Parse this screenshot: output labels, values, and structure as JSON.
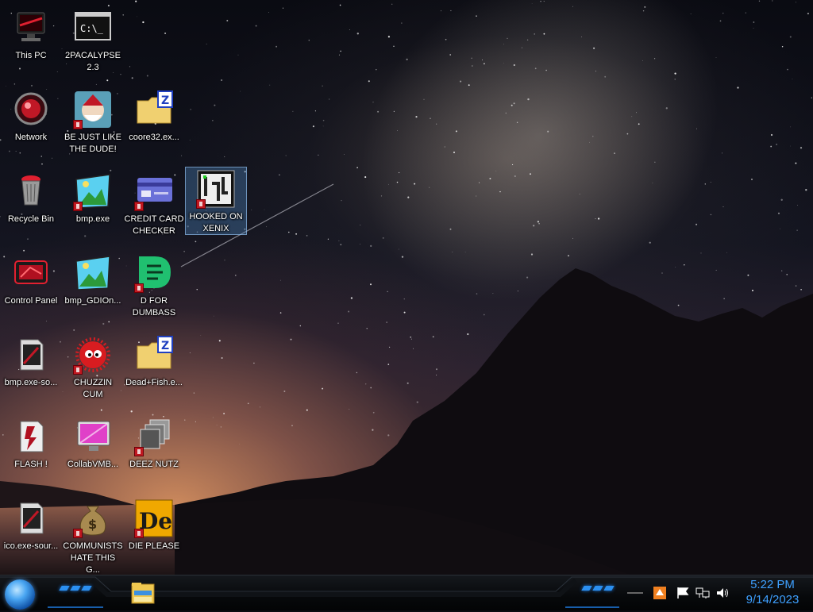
{
  "desktop": {
    "icons": [
      {
        "id": "this-pc",
        "label": "This PC"
      },
      {
        "id": "2pacalypse",
        "label": "2PACALYPSE 2.3"
      },
      {
        "id": "network",
        "label": "Network"
      },
      {
        "id": "be-just-like",
        "label": "BE JUST LIKE THE DUDE!"
      },
      {
        "id": "coore32",
        "label": "coore32.ex..."
      },
      {
        "id": "recycle-bin",
        "label": "Recycle Bin"
      },
      {
        "id": "bmp-exe",
        "label": "bmp.exe"
      },
      {
        "id": "credit-card",
        "label": "CREDIT CARD CHECKER"
      },
      {
        "id": "hooked-on",
        "label": "HOOKED ON XENIX"
      },
      {
        "id": "control-panel",
        "label": "Control Panel"
      },
      {
        "id": "bmp-gdion",
        "label": "bmp_GDIOn..."
      },
      {
        "id": "d-for",
        "label": "D FOR DUMBASS"
      },
      {
        "id": "bmp-exe-so",
        "label": "bmp.exe-so..."
      },
      {
        "id": "chuzzin",
        "label": "CHUZZIN CUM"
      },
      {
        "id": "dead-fish",
        "label": "Dead+Fish.e..."
      },
      {
        "id": "flash",
        "label": "FLASH !"
      },
      {
        "id": "collabvm",
        "label": "CollabVMB..."
      },
      {
        "id": "deez",
        "label": "DEEZ NUTZ"
      },
      {
        "id": "ico-exe",
        "label": "ico.exe-sour..."
      },
      {
        "id": "communists",
        "label": "COMMUNISTS HATE THIS G..."
      },
      {
        "id": "die-please",
        "label": "DIE PLEASE"
      }
    ],
    "selected": "HOOKED ON XENIX"
  },
  "taskbar": {
    "start": "start-orb",
    "pinned": [
      {
        "name": "file-explorer-icon"
      }
    ],
    "tray_icons": [
      "show-hidden-icon",
      "flag-icon",
      "network-icon",
      "volume-icon"
    ],
    "clock": {
      "time": "5:22 PM",
      "date": "9/14/2023"
    }
  },
  "colors": {
    "clock_text": "#3ea0ff",
    "accent_blue": "#2b8ff0",
    "selection": "#508cc8"
  }
}
